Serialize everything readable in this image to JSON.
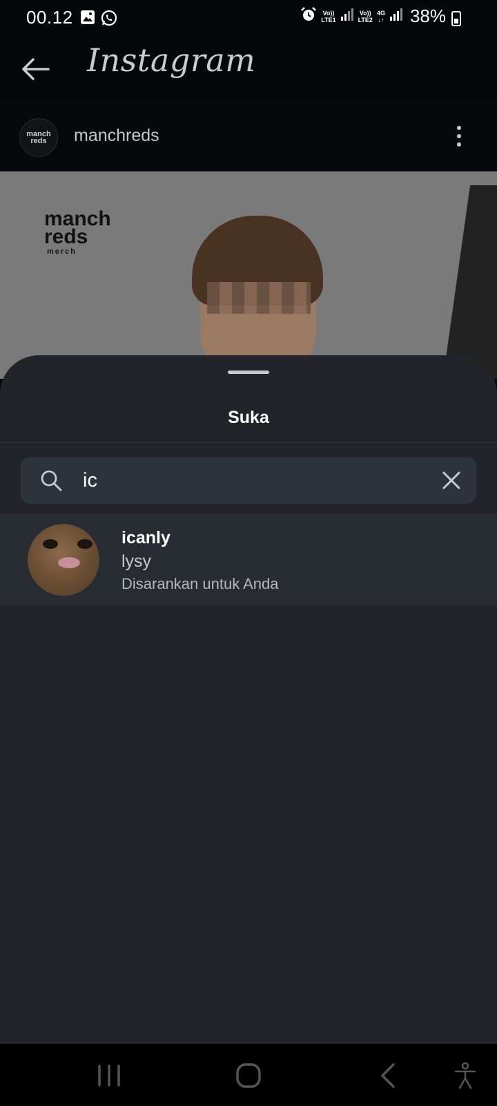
{
  "status_bar": {
    "time": "00.12",
    "left_icons": [
      "gallery-icon",
      "whatsapp-icon"
    ],
    "right_icons": [
      "alarm-icon",
      "volte-lte1-icon",
      "signal-icon",
      "volte-lte2-icon",
      "4g-icon",
      "signal-icon",
      "battery-icon"
    ],
    "sim1_label_top": "Vo))",
    "sim1_label_bottom": "LTE1",
    "sim2_label_top": "Vo))",
    "sim2_label_bottom": "LTE2",
    "network_label": "4G",
    "battery": "38%"
  },
  "app_bar": {
    "logo": "Instagram"
  },
  "post": {
    "avatar_line1": "manch",
    "avatar_line2": "reds",
    "username": "manchreds",
    "brand_line1": "manch",
    "brand_line2": "reds",
    "brand_tagline": "merch"
  },
  "sheet": {
    "title": "Suka",
    "search": {
      "value": "ic"
    },
    "results": [
      {
        "username": "icanly",
        "full_name": "lysy",
        "subtitle": "Disarankan untuk Anda"
      }
    ]
  },
  "nav_bar": {
    "items": [
      "recents-icon",
      "home-icon",
      "back-icon",
      "accessibility-icon"
    ]
  },
  "colors": {
    "background": "#050608",
    "sheet": "#22242a",
    "search_field": "#2d333b",
    "result_row": "#272b32"
  }
}
